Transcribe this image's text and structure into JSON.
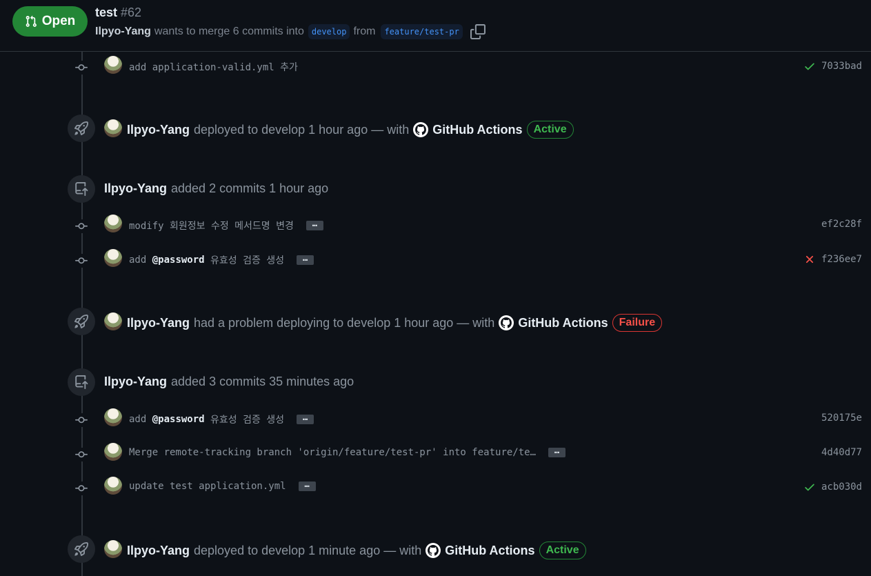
{
  "pr": {
    "state": "Open",
    "title": "test",
    "number": "#62",
    "author": "Ilpyo-Yang",
    "merge_text": "wants to merge 6 commits into",
    "base_branch": "develop",
    "from_text": "from",
    "head_branch": "feature/test-pr"
  },
  "commits_top": [
    {
      "message": "add application-valid.yml 추가",
      "sha": "7033bad",
      "status": "success"
    }
  ],
  "deploy_1": {
    "author": "Ilpyo-Yang",
    "text": "deployed to develop 1 hour ago — with",
    "app": "GitHub Actions",
    "status": "Active"
  },
  "push_1": {
    "author": "Ilpyo-Yang",
    "text": "added 2 commits 1 hour ago"
  },
  "commits_push_1": [
    {
      "message": "modify 회원정보 수정 메서드명 변경",
      "sha": "ef2c28f",
      "status": "none",
      "ellipsis": "…"
    },
    {
      "message_prefix": "add",
      "mention": "@password",
      "message_suffix": "유효성 검증 생성",
      "sha": "f236ee7",
      "status": "failure",
      "ellipsis": "…"
    }
  ],
  "deploy_2": {
    "author": "Ilpyo-Yang",
    "text": "had a problem deploying to develop 1 hour ago — with",
    "app": "GitHub Actions",
    "status": "Failure"
  },
  "push_2": {
    "author": "Ilpyo-Yang",
    "text": "added 3 commits 35 minutes ago"
  },
  "commits_push_2": [
    {
      "message_prefix": "add",
      "mention": "@password",
      "message_suffix": "유효성 검증 생성",
      "sha": "520175e",
      "status": "none",
      "ellipsis": "…"
    },
    {
      "message": "Merge remote-tracking branch 'origin/feature/test-pr' into feature/te…",
      "sha": "4d40d77",
      "status": "none",
      "ellipsis": "…"
    },
    {
      "message": "update test application.yml",
      "sha": "acb030d",
      "status": "success",
      "ellipsis": "…"
    }
  ],
  "deploy_3": {
    "author": "Ilpyo-Yang",
    "text": "deployed to develop 1 minute ago — with",
    "app": "GitHub Actions",
    "status": "Active"
  },
  "colors": {
    "background": "#0d1117",
    "open_green": "#238636",
    "success": "#3fb950",
    "failure": "#f85149",
    "link_blue": "#4493f8"
  },
  "icons": [
    "git-pull-request-icon",
    "copy-icon",
    "git-commit-icon",
    "rocket-icon",
    "repo-push-icon",
    "check-icon",
    "x-icon",
    "github-logo-icon"
  ]
}
